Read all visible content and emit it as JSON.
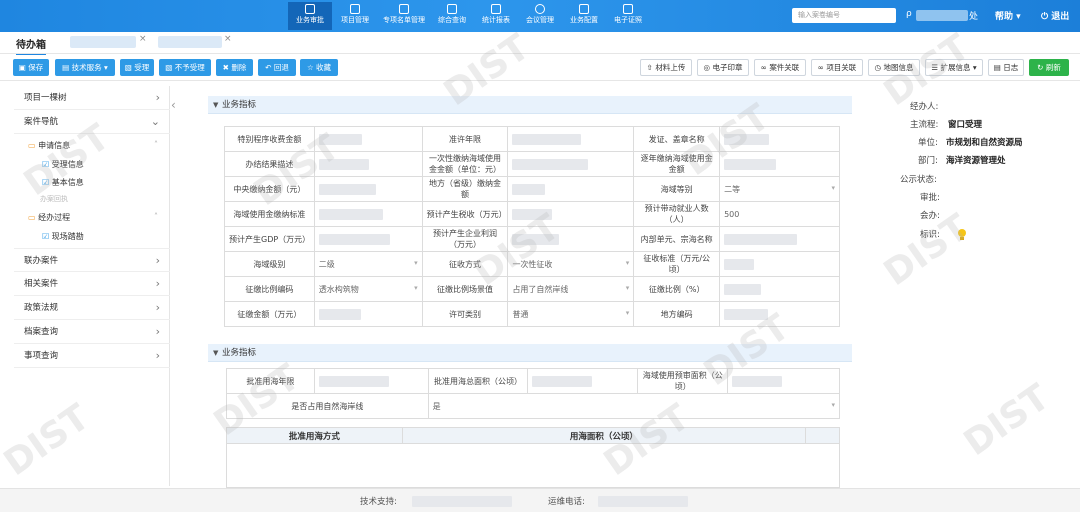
{
  "topnav": {
    "items": [
      {
        "label": "业务审批",
        "active": true
      },
      {
        "label": "项目管理"
      },
      {
        "label": "专项名单管理"
      },
      {
        "label": "综合查询"
      },
      {
        "label": "统计报表"
      },
      {
        "label": "会议管理"
      },
      {
        "label": "业务配置"
      },
      {
        "label": "电子证照"
      }
    ],
    "search_placeholder": "输入案卷编号",
    "user_suffix": "处",
    "help": "帮助",
    "logout": "退出"
  },
  "tabs": {
    "active": "待办箱",
    "close": "×"
  },
  "toolbar": {
    "left": [
      "保存",
      "技术服务 ▾",
      "受理",
      "不予受理",
      "删除",
      "回退",
      "收藏"
    ],
    "right": [
      "材料上传",
      "电子印章",
      "案件关联",
      "项目关联",
      "地图信息",
      "扩展信息 ▾",
      "日志"
    ],
    "refresh": "刷新"
  },
  "sidebar": {
    "items": [
      "项目一棵树",
      "案件导航",
      "联办案件",
      "相关案件",
      "政策法规",
      "档案查询",
      "事项查询"
    ],
    "groups": [
      {
        "label": "申请信息",
        "children": [
          "受理信息",
          "基本信息"
        ]
      },
      {
        "label": "经办过程",
        "children": [
          "现场踏勘"
        ]
      }
    ],
    "faint": "办案回执"
  },
  "section1": {
    "title": "业务指标",
    "rows": [
      [
        "特别程序收费金额",
        "",
        "准许年限",
        "",
        "发证、盖章名称",
        ""
      ],
      [
        "办结结果描述",
        "",
        "一次性缴纳海域使用金金额（单位：元）",
        "",
        "逐年缴纳海域使用金金额",
        ""
      ],
      [
        "中央缴纳金额（元）",
        "",
        "地方（省级）缴纳金额",
        "",
        "海域等别",
        "二等"
      ],
      [
        "海域使用金缴纳标准",
        "",
        "预计产生税收（万元）",
        "",
        "预计带动就业人数（人）",
        "500"
      ],
      [
        "预计产生GDP（万元）",
        "",
        "预计产生企业利润（万元）",
        "",
        "内部单元、宗海名称",
        ""
      ],
      [
        "海域级别",
        "二级",
        "征收方式",
        "一次性征收",
        "征收标准（万元/公顷）",
        ""
      ],
      [
        "征缴比例编码",
        "透水构筑物",
        "征缴比例场景值",
        "占用了自然岸线",
        "征缴比例（%）",
        ""
      ],
      [
        "征缴金额（万元）",
        "",
        "许可类别",
        "普通",
        "地方编码",
        ""
      ]
    ]
  },
  "section2": {
    "title": "业务指标",
    "rows": [
      [
        "批准用海年限",
        "",
        "批准用海总面积（公顷）",
        "",
        "海域使用预审面积（公顷）",
        ""
      ],
      [
        "是否占用自然海岸线",
        "是"
      ]
    ],
    "table_headers": [
      "批准用海方式",
      "用海面积（公顷）"
    ]
  },
  "rightpanel": {
    "labels": [
      "经办人:",
      "主流程:",
      "单位:",
      "部门:",
      "公示状态:",
      "审批:",
      "会办:",
      "标识:"
    ],
    "values": [
      "",
      "窗口受理",
      "市规划和自然资源局",
      "海洋资源管理处",
      "",
      "",
      "",
      ""
    ]
  },
  "footer": {
    "support": "技术支持:",
    "phone": "运维电话:"
  },
  "watermark": "DIST",
  "colors": {
    "nav": "#1f86e0",
    "button": "#2e9ae6",
    "refresh": "#2db34a",
    "folder": "#f2a23a"
  }
}
